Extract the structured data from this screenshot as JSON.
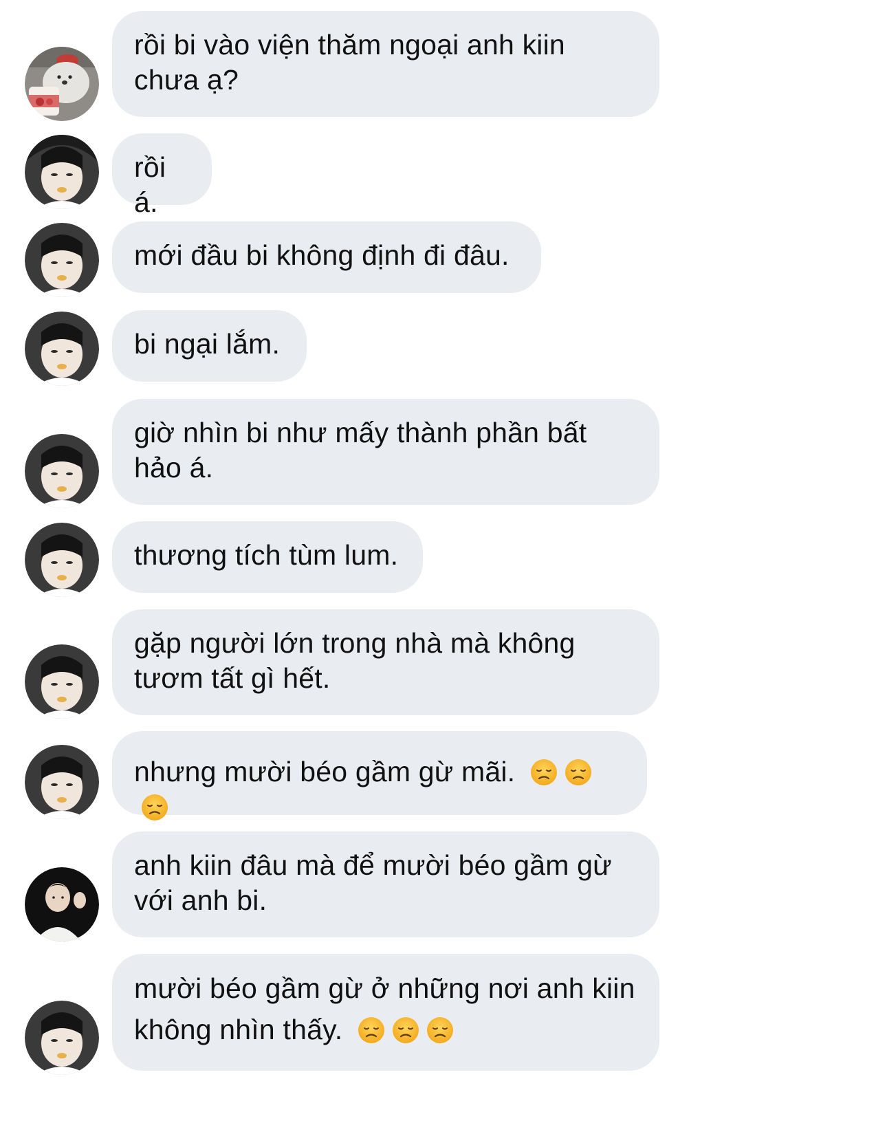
{
  "colors": {
    "bubble_bg": "#e9ecf0",
    "text": "#111111",
    "page_bg": "#ffffff"
  },
  "messages": [
    {
      "sender": "bear-avatar",
      "text": "rồi bi vào viện thăm ngoại anh kiin\nchưa ạ?",
      "emojis": []
    },
    {
      "sender": "bi-avatar",
      "text": "rồi á.",
      "emojis": []
    },
    {
      "sender": "bi-avatar",
      "text": "mới đầu bi không định đi đâu.",
      "emojis": []
    },
    {
      "sender": "bi-avatar",
      "text": "bi ngại lắm.",
      "emojis": []
    },
    {
      "sender": "bi-avatar",
      "text": "giờ nhìn bi như mấy thành phần bất\nhảo á.",
      "emojis": []
    },
    {
      "sender": "bi-avatar",
      "text": "thương tích tùm lum.",
      "emojis": []
    },
    {
      "sender": "bi-avatar",
      "text": "gặp người lớn trong nhà mà không\ntươm tất gì hết.",
      "emojis": []
    },
    {
      "sender": "bi-avatar",
      "text": "nhưng mười béo gầm gừ mãi.",
      "emojis": [
        "disappointed-face",
        "disappointed-face",
        "disappointed-face"
      ]
    },
    {
      "sender": "kiin-avatar",
      "text": "anh kiin đâu mà để mười béo gầm gừ\nvới anh bi.",
      "emojis": []
    },
    {
      "sender": "bi-avatar",
      "text": "mười béo gầm gừ ở những nơi anh kiin\nkhông nhìn thấy.",
      "emojis": [
        "disappointed-face",
        "disappointed-face",
        "disappointed-face"
      ]
    }
  ]
}
